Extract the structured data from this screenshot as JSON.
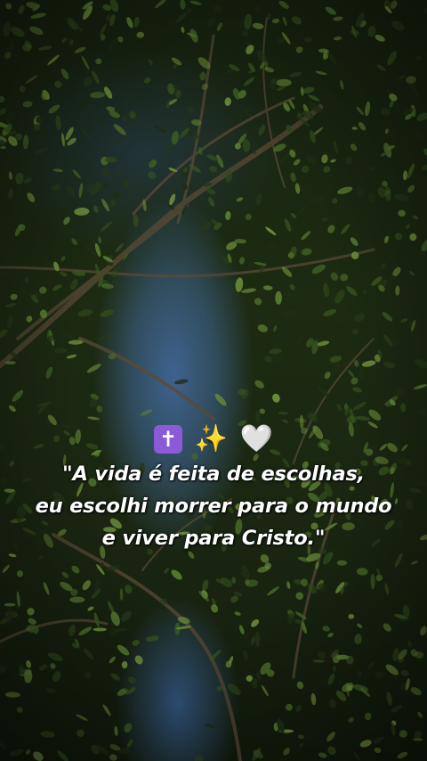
{
  "background": {
    "description_icon": "tree-canopy-photo",
    "sky_color": "#40669a",
    "leaf_color": "#3a5a22"
  },
  "overlay": {
    "emojis": {
      "cross": "✝",
      "sparkles": "✨",
      "heart": "🤍"
    },
    "quote_lines": [
      "\"A vida é feita de escolhas,",
      "eu escolhi morrer para o mundo",
      "e viver para Cristo.\""
    ]
  }
}
